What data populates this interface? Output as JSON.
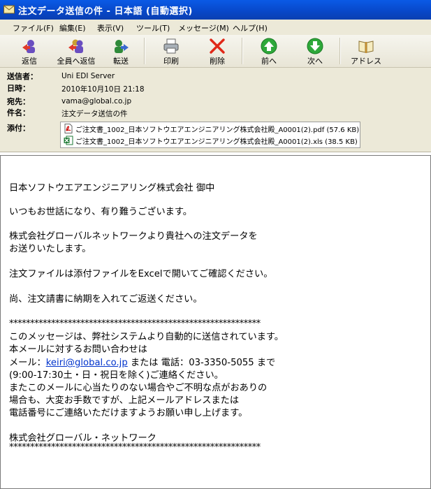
{
  "window": {
    "title": "注文データ送信の件 - 日本語 (自動選択)"
  },
  "menu": [
    "ファイル(F)",
    "編集(E)",
    "表示(V)",
    "ツール(T)",
    "メッセージ(M)",
    "ヘルプ(H)"
  ],
  "toolbar": {
    "reply": "返信",
    "reply_all": "全員へ返信",
    "forward": "転送",
    "print": "印刷",
    "delete": "削除",
    "previous": "前へ",
    "next": "次へ",
    "addresses": "アドレス"
  },
  "header": {
    "from_label": "送信者：",
    "from_value": "Uni EDI Server",
    "date_label": "日時：",
    "date_value": "2010年10月10日 21:18",
    "to_label": "宛先：",
    "to_value": "vama@global.co.jp",
    "subject_label": "件名：",
    "subject_value": "注文データ送信の件",
    "attach_label": "添付："
  },
  "attachments": [
    {
      "name": "ご注文書_1002_日本ソフトウエアエンジニアリング株式会社殿_A0001(2).pdf (57.6 KB)",
      "icon": "pdf-icon",
      "color": "#cc0000"
    },
    {
      "name": "ご注文書_1002_日本ソフトウエアエンジニアリング株式会社殿_A0001(2).xls (38.5 KB)",
      "icon": "excel-icon",
      "color": "#1e7a34"
    }
  ],
  "body": {
    "line1": "日本ソフトウエアエンジニアリング株式会社 御中",
    "line2": "いつもお世話になり、有り難うございます。",
    "line3": "株式会社グローバルネットワークより貴社への注文データを",
    "line4": "お送りいたします。",
    "line5": "注文ファイルは添付ファイルをExcelで開いてご確認ください。",
    "line6": "尚、注文請書に納期を入れてご返送ください。",
    "stars1": "************************************************************",
    "line7": "このメッセージは、弊社システムより自動的に送信されています。",
    "line8": "本メールに対するお問い合わせは",
    "mail_prefix": "メール：",
    "mail_link": "keiri@global.co.jp",
    "mail_suffix": " または 電話：03-3350-5055 まで",
    "line10": "(9:00-17:30土・日・祝日を除く)ご連絡ください。",
    "line11": "またこのメールに心当たりのない場合やご不明な点がおありの",
    "line12": "場合も、大変お手数ですが、上記メールアドレスまたは",
    "line13": "電話番号にご連絡いただけますようお願い申し上げます。",
    "signature": "株式会社グローバル・ネットワーク",
    "stars2": "************************************************************"
  }
}
